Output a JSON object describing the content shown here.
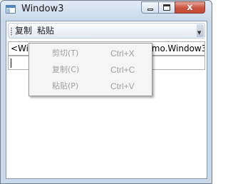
{
  "window": {
    "title": "Window3",
    "close_glyph": "x",
    "icons": {
      "app": "window-app-icon",
      "minimize": "minimize-icon",
      "maximize": "maximize-icon",
      "close": "close-icon",
      "overflow": "toolbar-overflow-icon"
    }
  },
  "toolbar": {
    "copy_label": "复制",
    "paste_label": "粘贴",
    "overflow_glyph": "▼"
  },
  "textbox": {
    "value": "<Window x:Class=\"CommandDemo.Window3\""
  },
  "context_menu": {
    "items": [
      {
        "label": "剪切(T)",
        "shortcut": "Ctrl+X",
        "enabled": false
      },
      {
        "label": "复制(C)",
        "shortcut": "Ctrl+C",
        "enabled": false
      },
      {
        "label": "粘贴(P)",
        "shortcut": "Ctrl+V",
        "enabled": false
      }
    ]
  },
  "colors": {
    "frame": "#c9d8ea",
    "close_button": "#c9533f",
    "disabled_text": "#a0a0a0"
  }
}
